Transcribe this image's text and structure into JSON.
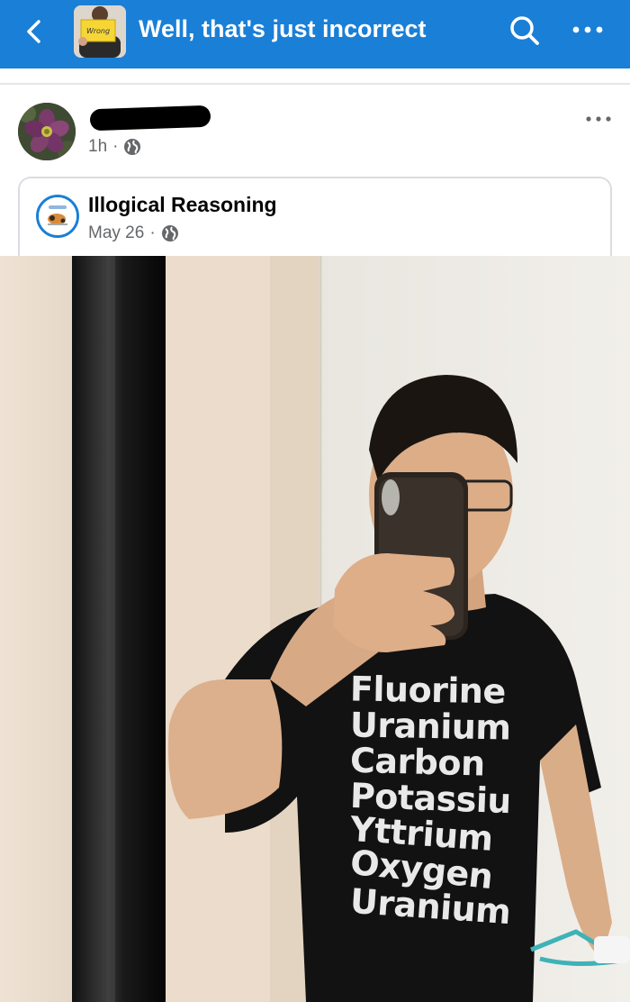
{
  "appbar": {
    "title": "Well, that's just incorrect",
    "back_icon": "chevron-left-icon",
    "search_icon": "search-icon",
    "more_icon": "more-horizontal-icon",
    "thumbnail_note": "Wrong",
    "bg_color": "#1a7fd6"
  },
  "post": {
    "time": "1h",
    "dot": "·",
    "privacy_icon": "globe-icon"
  },
  "shared": {
    "page_name": "Illogical Reasoning",
    "date": "May 26",
    "dot": "·",
    "privacy_icon": "globe-icon"
  },
  "photo": {
    "shirt_lines": [
      "Fluorine",
      "Uranium",
      "Carbon",
      "Potassium",
      "Yttrium",
      "Oxygen",
      "Uranium"
    ]
  }
}
